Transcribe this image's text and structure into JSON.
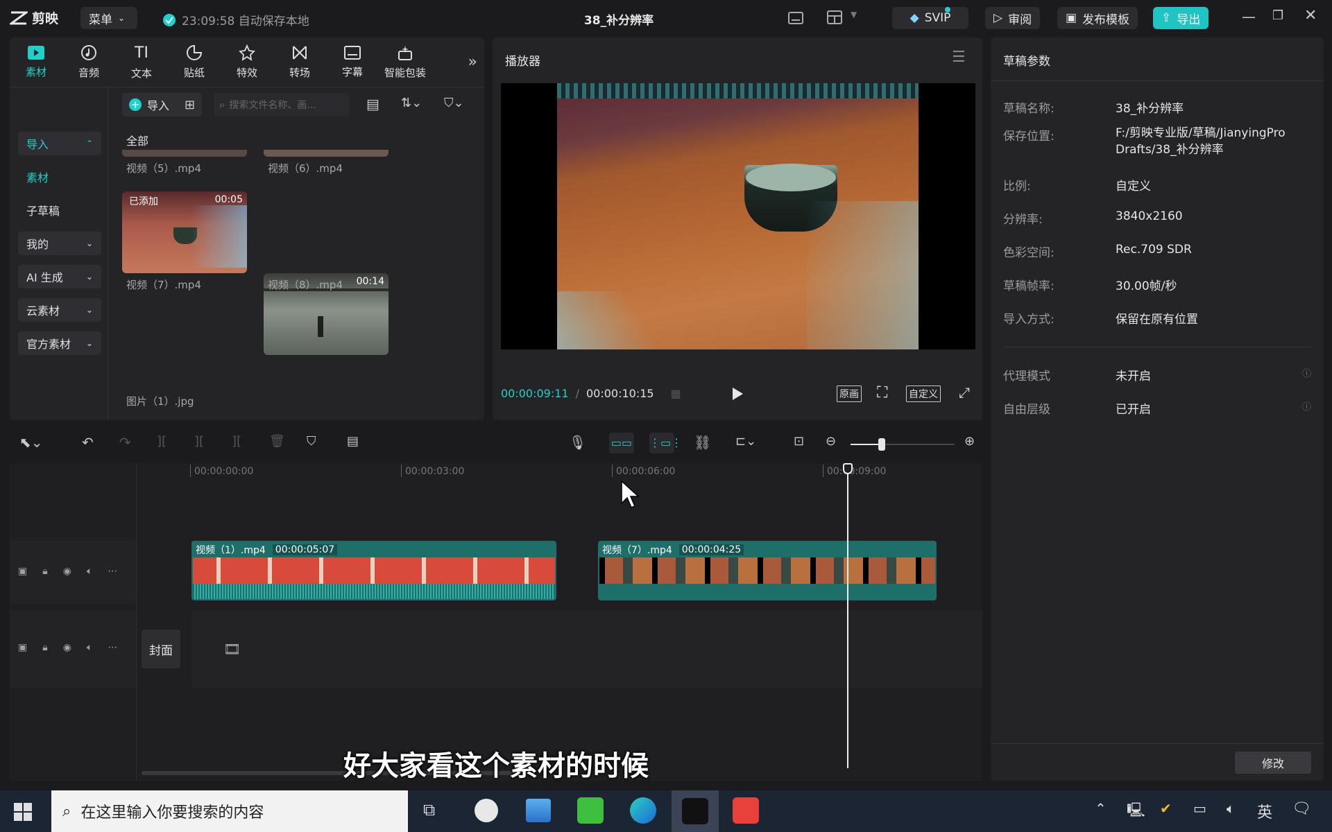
{
  "app": {
    "logo_text": "剪映",
    "menu_label": "菜单",
    "autosave_text": "23:09:58 自动保存本地",
    "project_title": "38_补分辨率",
    "svip_label": "SVIP",
    "review_label": "审阅",
    "publish_template_label": "发布模板",
    "export_label": "导出"
  },
  "toolbar_tabs": [
    {
      "label": "素材",
      "icon": "media-icon"
    },
    {
      "label": "音频",
      "icon": "audio-icon"
    },
    {
      "label": "文本",
      "icon": "text-icon"
    },
    {
      "label": "贴纸",
      "icon": "sticker-icon"
    },
    {
      "label": "特效",
      "icon": "effects-icon"
    },
    {
      "label": "转场",
      "icon": "transition-icon"
    },
    {
      "label": "字幕",
      "icon": "subtitle-icon"
    },
    {
      "label": "智能包装",
      "icon": "smart-pack-icon"
    }
  ],
  "sidebar": {
    "import": "导入",
    "material": "素材",
    "sub_draft": "子草稿",
    "mine": "我的",
    "ai_gen": "AI 生成",
    "cloud": "云素材",
    "official": "官方素材"
  },
  "media": {
    "import_button": "导入",
    "search_placeholder": "搜索文件名称、画...",
    "filter_all": "全部",
    "items": [
      {
        "label": "视频（5）.mp4"
      },
      {
        "label": "视频（6）.mp4"
      },
      {
        "label": "视频（7）.mp4",
        "duration": "00:05",
        "badge": "已添加"
      },
      {
        "label": "视频（8）.mp4",
        "duration": "00:14"
      },
      {
        "label": "图片（1）.jpg"
      }
    ]
  },
  "player": {
    "title": "播放器",
    "current_time": "00:00:09:11",
    "separator": "/",
    "total_time": "00:00:10:15",
    "original_label": "原画",
    "custom_label": "自定义"
  },
  "draft_params": {
    "title": "草稿参数",
    "rows": [
      {
        "key": "草稿名称:",
        "value": "38_补分辨率"
      },
      {
        "key": "保存位置:",
        "value": "F:/剪映专业版/草稿/JianyingPro Drafts/38_补分辨率"
      },
      {
        "key": "比例:",
        "value": "自定义"
      },
      {
        "key": "分辨率:",
        "value": "3840x2160"
      },
      {
        "key": "色彩空间:",
        "value": "Rec.709 SDR"
      },
      {
        "key": "草稿帧率:",
        "value": "30.00帧/秒"
      },
      {
        "key": "导入方式:",
        "value": "保留在原有位置"
      }
    ],
    "rows2": [
      {
        "key": "代理模式",
        "value": "未开启"
      },
      {
        "key": "自由层级",
        "value": "已开启"
      }
    ],
    "modify_button": "修改"
  },
  "timeline": {
    "ruler": [
      "00:00:00:00",
      "00:00:03:00",
      "00:00:06:00",
      "00:00:09:00"
    ],
    "zoom_level": 0.3,
    "clips": [
      {
        "name": "视频（1）.mp4",
        "duration": "00:00:05:07"
      },
      {
        "name": "视频（7）.mp4",
        "duration": "00:00:04:25"
      }
    ],
    "cover_label": "封面"
  },
  "subtitle_overlay": "好大家看这个素材的时候",
  "taskbar": {
    "search_placeholder": "在这里输入你要搜索的内容",
    "ime_label": "英"
  },
  "colors": {
    "accent": "#1fd1cb",
    "clip": "#1e6e6a",
    "background": "#1b1b1d",
    "panel": "#242427"
  }
}
